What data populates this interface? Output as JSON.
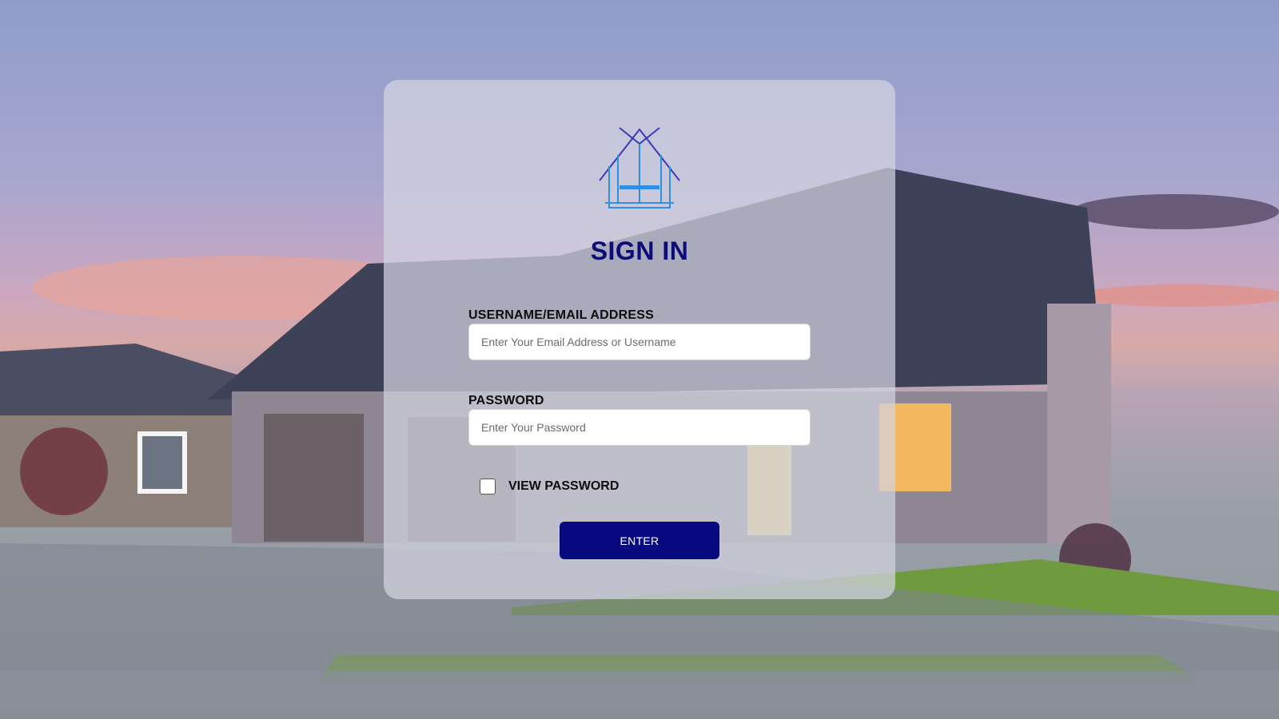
{
  "page": {
    "title": "SIGN IN",
    "logo_icon": "house-outline-logo",
    "background": "suburban-house-at-sunset-photo"
  },
  "form": {
    "username": {
      "label": "USERNAME/EMAIL ADDRESS",
      "placeholder": "Enter Your Email Address or Username",
      "value": ""
    },
    "password": {
      "label": "PASSWORD",
      "placeholder": "Enter Your Password",
      "value": ""
    },
    "view_password": {
      "label": "VIEW PASSWORD",
      "checked": false
    },
    "submit_label": "ENTER"
  },
  "colors": {
    "title": "#0b0b7a",
    "button": "#0a0a80",
    "logo_outline": "#3a3ab8",
    "logo_accent": "#2f8fe0"
  }
}
